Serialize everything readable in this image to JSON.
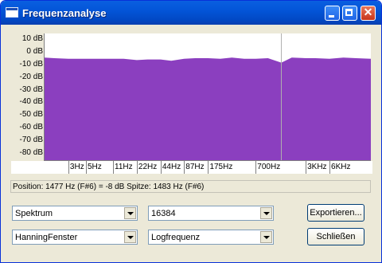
{
  "window": {
    "title": "Frequenzanalyse"
  },
  "chart_data": {
    "type": "area",
    "title": "",
    "xlabel": "",
    "ylabel": "",
    "y_unit": "dB",
    "y_ticks": [
      "10 dB",
      "0 dB",
      "-10 dB",
      "-20 dB",
      "-30 dB",
      "-40 dB",
      "-50 dB",
      "-60 dB",
      "-70 dB",
      "-80 dB"
    ],
    "ylim": [
      -85,
      15
    ],
    "x_scale": "log",
    "x_ticks": [
      "3Hz",
      "5Hz",
      "11Hz",
      "22Hz",
      "44Hz",
      "87Hz",
      "175Hz",
      "700Hz",
      "3KHz",
      "6KHz"
    ],
    "x_tick_values_hz": [
      3,
      5,
      11,
      22,
      44,
      87,
      175,
      700,
      3000,
      6000
    ],
    "xlim_hz": [
      1.5,
      20000
    ],
    "cursor_hz": 1477,
    "fill_color": "#8b3fbf",
    "grid": false,
    "series": [
      {
        "x_hz": [
          1.5,
          2,
          3,
          5,
          8,
          11,
          15,
          22,
          30,
          44,
          60,
          87,
          120,
          175,
          250,
          350,
          500,
          700,
          1000,
          1477,
          2000,
          3000,
          4000,
          6000,
          9000,
          13000,
          20000
        ],
        "y_db": [
          -4.0,
          -4.5,
          -5.0,
          -5.0,
          -5.0,
          -5.0,
          -5.0,
          -6.0,
          -5.5,
          -5.5,
          -6.5,
          -5.0,
          -4.5,
          -4.5,
          -5.0,
          -4.0,
          -5.0,
          -5.0,
          -4.5,
          -8.0,
          -4.0,
          -4.5,
          -4.5,
          -5.0,
          -4.0,
          -4.5,
          -5.0
        ]
      }
    ]
  },
  "status": {
    "text": "Position: 1477 Hz (F#6) = -8 dB   Spitze: 1483 Hz (F#6)"
  },
  "controls": {
    "analysis_type": "Spektrum",
    "size": "16384",
    "window_function": "HanningFenster",
    "axis_mode": "Logfrequenz",
    "export_label": "Exportieren...",
    "close_label": "Schließen"
  }
}
